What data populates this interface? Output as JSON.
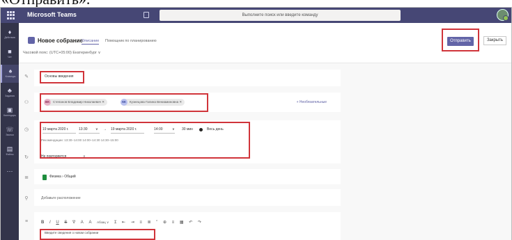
{
  "caption": "«Отправить».",
  "topbar": {
    "app_title": "Microsoft Teams",
    "search_text": "Выполните поиск или введите команду"
  },
  "rail": {
    "items": [
      {
        "icon": "activity-icon",
        "glyph": "♦",
        "label": "Действия"
      },
      {
        "icon": "chat-icon",
        "glyph": "■",
        "label": "Чат"
      },
      {
        "icon": "teams-icon",
        "glyph": "♠",
        "label": "Команды"
      },
      {
        "icon": "assignments-icon",
        "glyph": "♣",
        "label": "Задания"
      },
      {
        "icon": "calendar-icon",
        "glyph": "▣",
        "label": "Календарь"
      },
      {
        "icon": "calls-icon",
        "glyph": "☏",
        "label": "Звонки"
      },
      {
        "icon": "files-icon",
        "glyph": "▤",
        "label": "Файлы"
      },
      {
        "icon": "more-icon",
        "glyph": "···",
        "label": ""
      }
    ]
  },
  "header": {
    "title": "Новое собрание",
    "tabs": [
      "Описание",
      "Помощник по планированию"
    ],
    "send_label": "Отправить",
    "close_label": "Закрыть",
    "timezone": "Часовой пояс: (UTC+05:00) Екатеринбург ∨"
  },
  "form": {
    "title_value": "Основы введения",
    "attendees": [
      {
        "initials": "ВК",
        "name": "Степанов Владимир Николаевич ✕",
        "bg": "#e8b4c8",
        "fg": "#8b2a55"
      },
      {
        "initials": "КК",
        "name": "Кузнецова Галина Вениаминовна ✕",
        "bg": "#b9c1ef",
        "fg": "#33449a"
      }
    ],
    "optional_label": "+ Необязательные",
    "start_date": "19 марта 2020 г.",
    "start_time": "13:30",
    "end_date": "19 марта 2020 г.",
    "end_time": "14:00",
    "duration": "30 мин",
    "all_day": "Весь день",
    "suggestions": "Рекомендации: 13:30–14:00  14:00–14:30  14:30–15:00",
    "repeat": "Не повторяется",
    "channel": "Физика  ›  Общий",
    "location": "Добавьте расположение",
    "toolbar_icons": [
      "B",
      "I",
      "U",
      "S",
      "∇",
      "A",
      "A",
      "Абзац ∨",
      "Ɪ",
      "⇤",
      "⇥",
      "≡",
      "≣",
      "”",
      "⊕",
      "≡",
      "▦",
      "↶",
      "↷"
    ],
    "description": "Введите сведения о новом собрании"
  }
}
